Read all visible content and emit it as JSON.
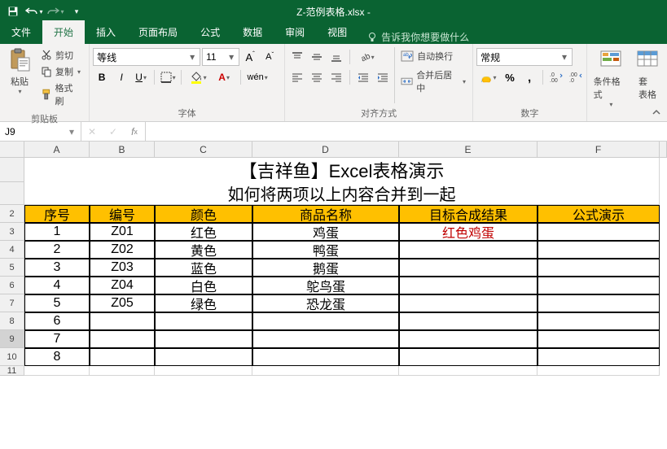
{
  "window": {
    "title": "Z-范例表格.xlsx - "
  },
  "menutabs": {
    "file": "文件",
    "home": "开始",
    "insert": "插入",
    "layout": "页面布局",
    "formula": "公式",
    "data": "数据",
    "review": "审阅",
    "view": "视图",
    "tellme": "告诉我你想要做什么"
  },
  "ribbon": {
    "clipboard": {
      "paste": "粘贴",
      "cut": "剪切",
      "copy": "复制",
      "fmtpainter": "格式刷",
      "label": "剪贴板"
    },
    "font": {
      "name": "等线",
      "size": "11",
      "label": "字体"
    },
    "align": {
      "wrap": "自动换行",
      "merge": "合并后居中",
      "label": "对齐方式"
    },
    "number": {
      "format": "常规",
      "label": "数字"
    },
    "styles": {
      "condfmt": "条件格式",
      "tablefmt": "套\n表格",
      "label": ""
    }
  },
  "formula": {
    "cellref": "J9",
    "value": ""
  },
  "columns": [
    "A",
    "B",
    "C",
    "D",
    "E",
    "F"
  ],
  "row_start": 1,
  "row_heights": {
    "title1": 30,
    "title2": 28,
    "header": 22,
    "data": 22
  },
  "sheet": {
    "title1": "【吉祥鱼】Excel表格演示",
    "title2": "如何将两项以上内容合并到一起",
    "headers": [
      "序号",
      "编号",
      "颜色",
      "商品名称",
      "目标合成结果",
      "公式演示"
    ],
    "rows": [
      {
        "n": "1",
        "code": "Z01",
        "color": "红色",
        "prod": "鸡蛋",
        "result": "红色鸡蛋",
        "demo": ""
      },
      {
        "n": "2",
        "code": "Z02",
        "color": "黄色",
        "prod": "鸭蛋",
        "result": "",
        "demo": ""
      },
      {
        "n": "3",
        "code": "Z03",
        "color": "蓝色",
        "prod": "鹅蛋",
        "result": "",
        "demo": ""
      },
      {
        "n": "4",
        "code": "Z04",
        "color": "白色",
        "prod": "鸵鸟蛋",
        "result": "",
        "demo": ""
      },
      {
        "n": "5",
        "code": "Z05",
        "color": "绿色",
        "prod": "恐龙蛋",
        "result": "",
        "demo": ""
      },
      {
        "n": "6",
        "code": "",
        "color": "",
        "prod": "",
        "result": "",
        "demo": ""
      },
      {
        "n": "7",
        "code": "",
        "color": "",
        "prod": "",
        "result": "",
        "demo": ""
      },
      {
        "n": "8",
        "code": "",
        "color": "",
        "prod": "",
        "result": "",
        "demo": ""
      }
    ]
  },
  "selected_row_index": 9
}
